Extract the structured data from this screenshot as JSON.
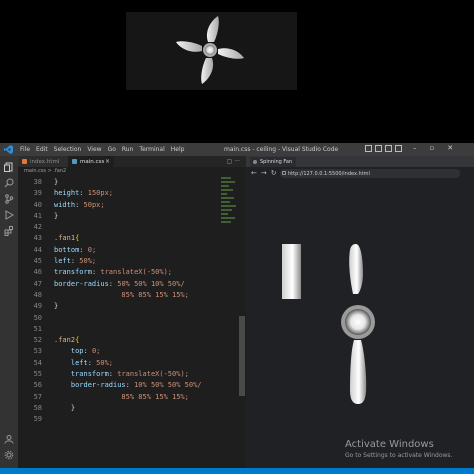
{
  "window": {
    "title": "main.css - ceiling - Visual Studio Code",
    "menu": [
      "File",
      "Edit",
      "Selection",
      "View",
      "Go",
      "Run",
      "Terminal",
      "Help"
    ]
  },
  "editor": {
    "tabs": [
      {
        "label": "index.html",
        "active": false
      },
      {
        "label": "main.css",
        "active": true
      }
    ],
    "breadcrumb": "main.css > .fan2",
    "lines": [
      {
        "num": "38",
        "text": "}"
      },
      {
        "num": "39",
        "text": "height: 150px;"
      },
      {
        "num": "40",
        "text": "width: 50px;"
      },
      {
        "num": "41",
        "text": "}"
      },
      {
        "num": "42",
        "text": ""
      },
      {
        "num": "43",
        "text": ".fan1{"
      },
      {
        "num": "44",
        "text": "bottom: 0;"
      },
      {
        "num": "45",
        "text": "left: 50%;"
      },
      {
        "num": "46",
        "text": "transform: translateX(-50%);"
      },
      {
        "num": "47",
        "text": "border-radius: 50% 50% 10% 50%/"
      },
      {
        "num": "48",
        "text": "                85% 85% 15% 15%;"
      },
      {
        "num": "49",
        "text": "}"
      },
      {
        "num": "50",
        "text": ""
      },
      {
        "num": "51",
        "text": ""
      },
      {
        "num": "52",
        "text": ".fan2{"
      },
      {
        "num": "53",
        "text": "    top: 0;"
      },
      {
        "num": "54",
        "text": "    left: 50%;"
      },
      {
        "num": "55",
        "text": "    transform: translateX(-50%);"
      },
      {
        "num": "56",
        "text": "    border-radius: 10% 50% 50% 50%/"
      },
      {
        "num": "57",
        "text": "                85% 85% 15% 15%;"
      },
      {
        "num": "58",
        "text": "    }"
      },
      {
        "num": "59",
        "text": ""
      }
    ]
  },
  "browser": {
    "tab_label": "Spinning Fan",
    "url": "http://127.0.0.1:5500/index.html"
  },
  "watermark": {
    "title": "Activate Windows",
    "subtitle": "Go to Settings to activate Windows."
  },
  "colors": {
    "editor_bg": "#1e1e1e",
    "activity_bar": "#333333",
    "title_bar": "#3c3c3c",
    "status_bar": "#007acc",
    "browser_bg": "#202124"
  },
  "icons": [
    "vscode-logo-icon",
    "explorer-icon",
    "search-icon",
    "source-control-icon",
    "run-debug-icon",
    "extensions-icon",
    "account-icon",
    "settings-gear-icon"
  ]
}
